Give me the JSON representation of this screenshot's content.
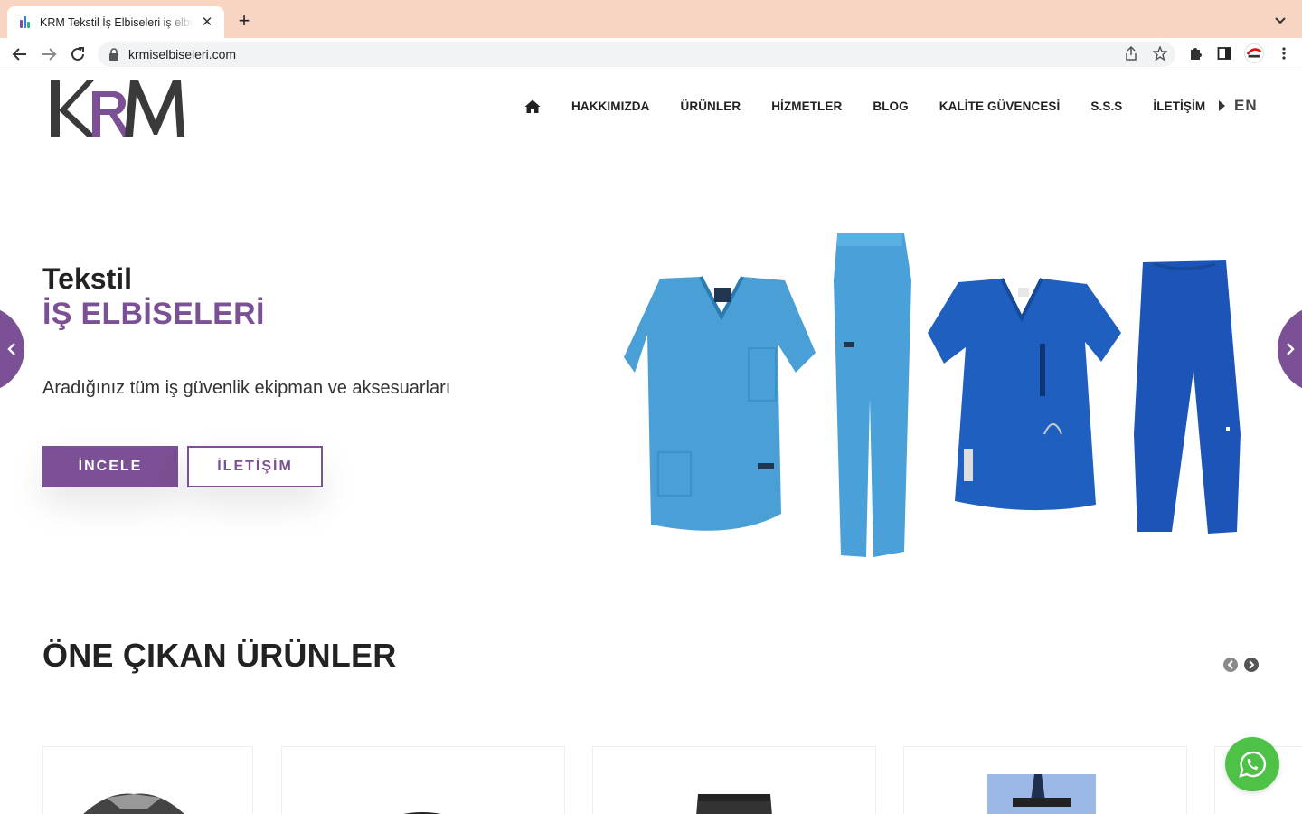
{
  "browser": {
    "tab_title": "KRM Tekstil İş Elbiseleri iş elbiseleri",
    "url": "krmiselbiseleri.com",
    "new_tab_symbol": "+",
    "close_symbol": "✕"
  },
  "header": {
    "logo_text": "KRM",
    "nav": {
      "about": "HAKKIMIZDA",
      "products": "ÜRÜNLER",
      "services": "HİZMETLER",
      "blog": "BLOG",
      "quality": "KALİTE GÜVENCESİ",
      "faq": "S.S.S",
      "contact": "İLETİŞİM"
    },
    "lang": "EN"
  },
  "hero": {
    "title_line1": "Tekstil",
    "title_line2": "İŞ ELBİSELERİ",
    "subtitle": "Aradığınız tüm iş güvenlik ekipman ve aksesuarları",
    "btn_primary": "İNCELE",
    "btn_secondary": "İLETİŞİM"
  },
  "featured": {
    "title": "ÖNE ÇIKAN ÜRÜNLER"
  },
  "colors": {
    "brand": "#7b5094",
    "tabstrip": "#f8d5c2",
    "whatsapp": "#4dc247"
  },
  "icons": [
    "home-icon",
    "chevron-left-icon",
    "chevron-right-icon",
    "whatsapp-icon",
    "lock-icon",
    "star-icon",
    "share-icon",
    "puzzle-icon",
    "sidepanel-icon",
    "menu-icon"
  ]
}
